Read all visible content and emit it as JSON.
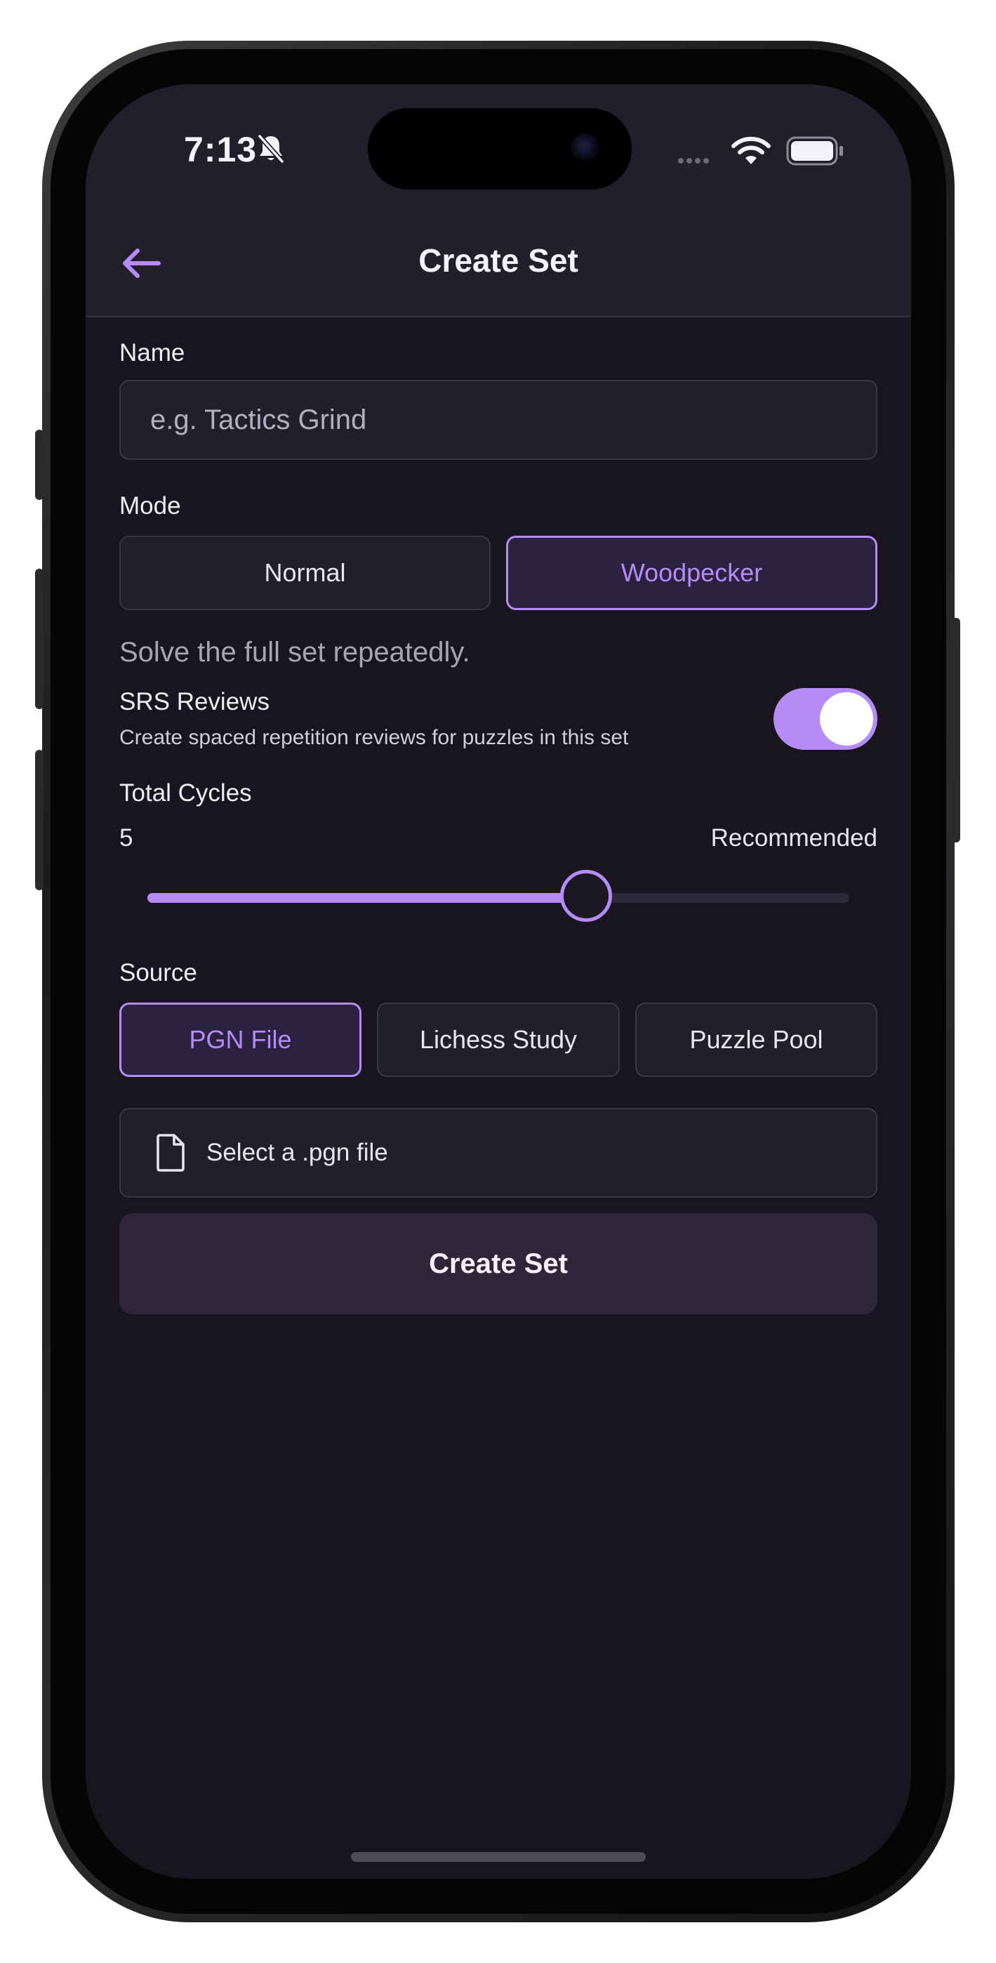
{
  "status_bar": {
    "time": "7:13",
    "icons": [
      "bell-slash-icon",
      "signal-dots-icon",
      "wifi-icon",
      "battery-icon"
    ]
  },
  "header": {
    "title": "Create Set",
    "back_icon": "arrow-left-icon"
  },
  "form": {
    "name": {
      "label": "Name",
      "placeholder": "e.g. Tactics Grind",
      "value": ""
    },
    "mode": {
      "label": "Mode",
      "options": [
        "Normal",
        "Woodpecker"
      ],
      "selected": "Woodpecker",
      "description": "Solve the full set repeatedly."
    },
    "srs": {
      "title": "SRS Reviews",
      "description": "Create spaced repetition reviews for puzzles in this set",
      "enabled": true
    },
    "cycles": {
      "label": "Total Cycles",
      "value": "5",
      "hint": "Recommended",
      "slider_fraction": 0.625
    },
    "source": {
      "label": "Source",
      "options": [
        "PGN File",
        "Lichess Study",
        "Puzzle Pool"
      ],
      "selected": "PGN File",
      "file_prompt": "Select a .pgn file",
      "file_icon": "document-icon"
    },
    "submit_label": "Create Set"
  },
  "colors": {
    "accent": "#b58cf6",
    "background": "#18151f",
    "surface": "#221f2b",
    "border": "#3a3645"
  }
}
